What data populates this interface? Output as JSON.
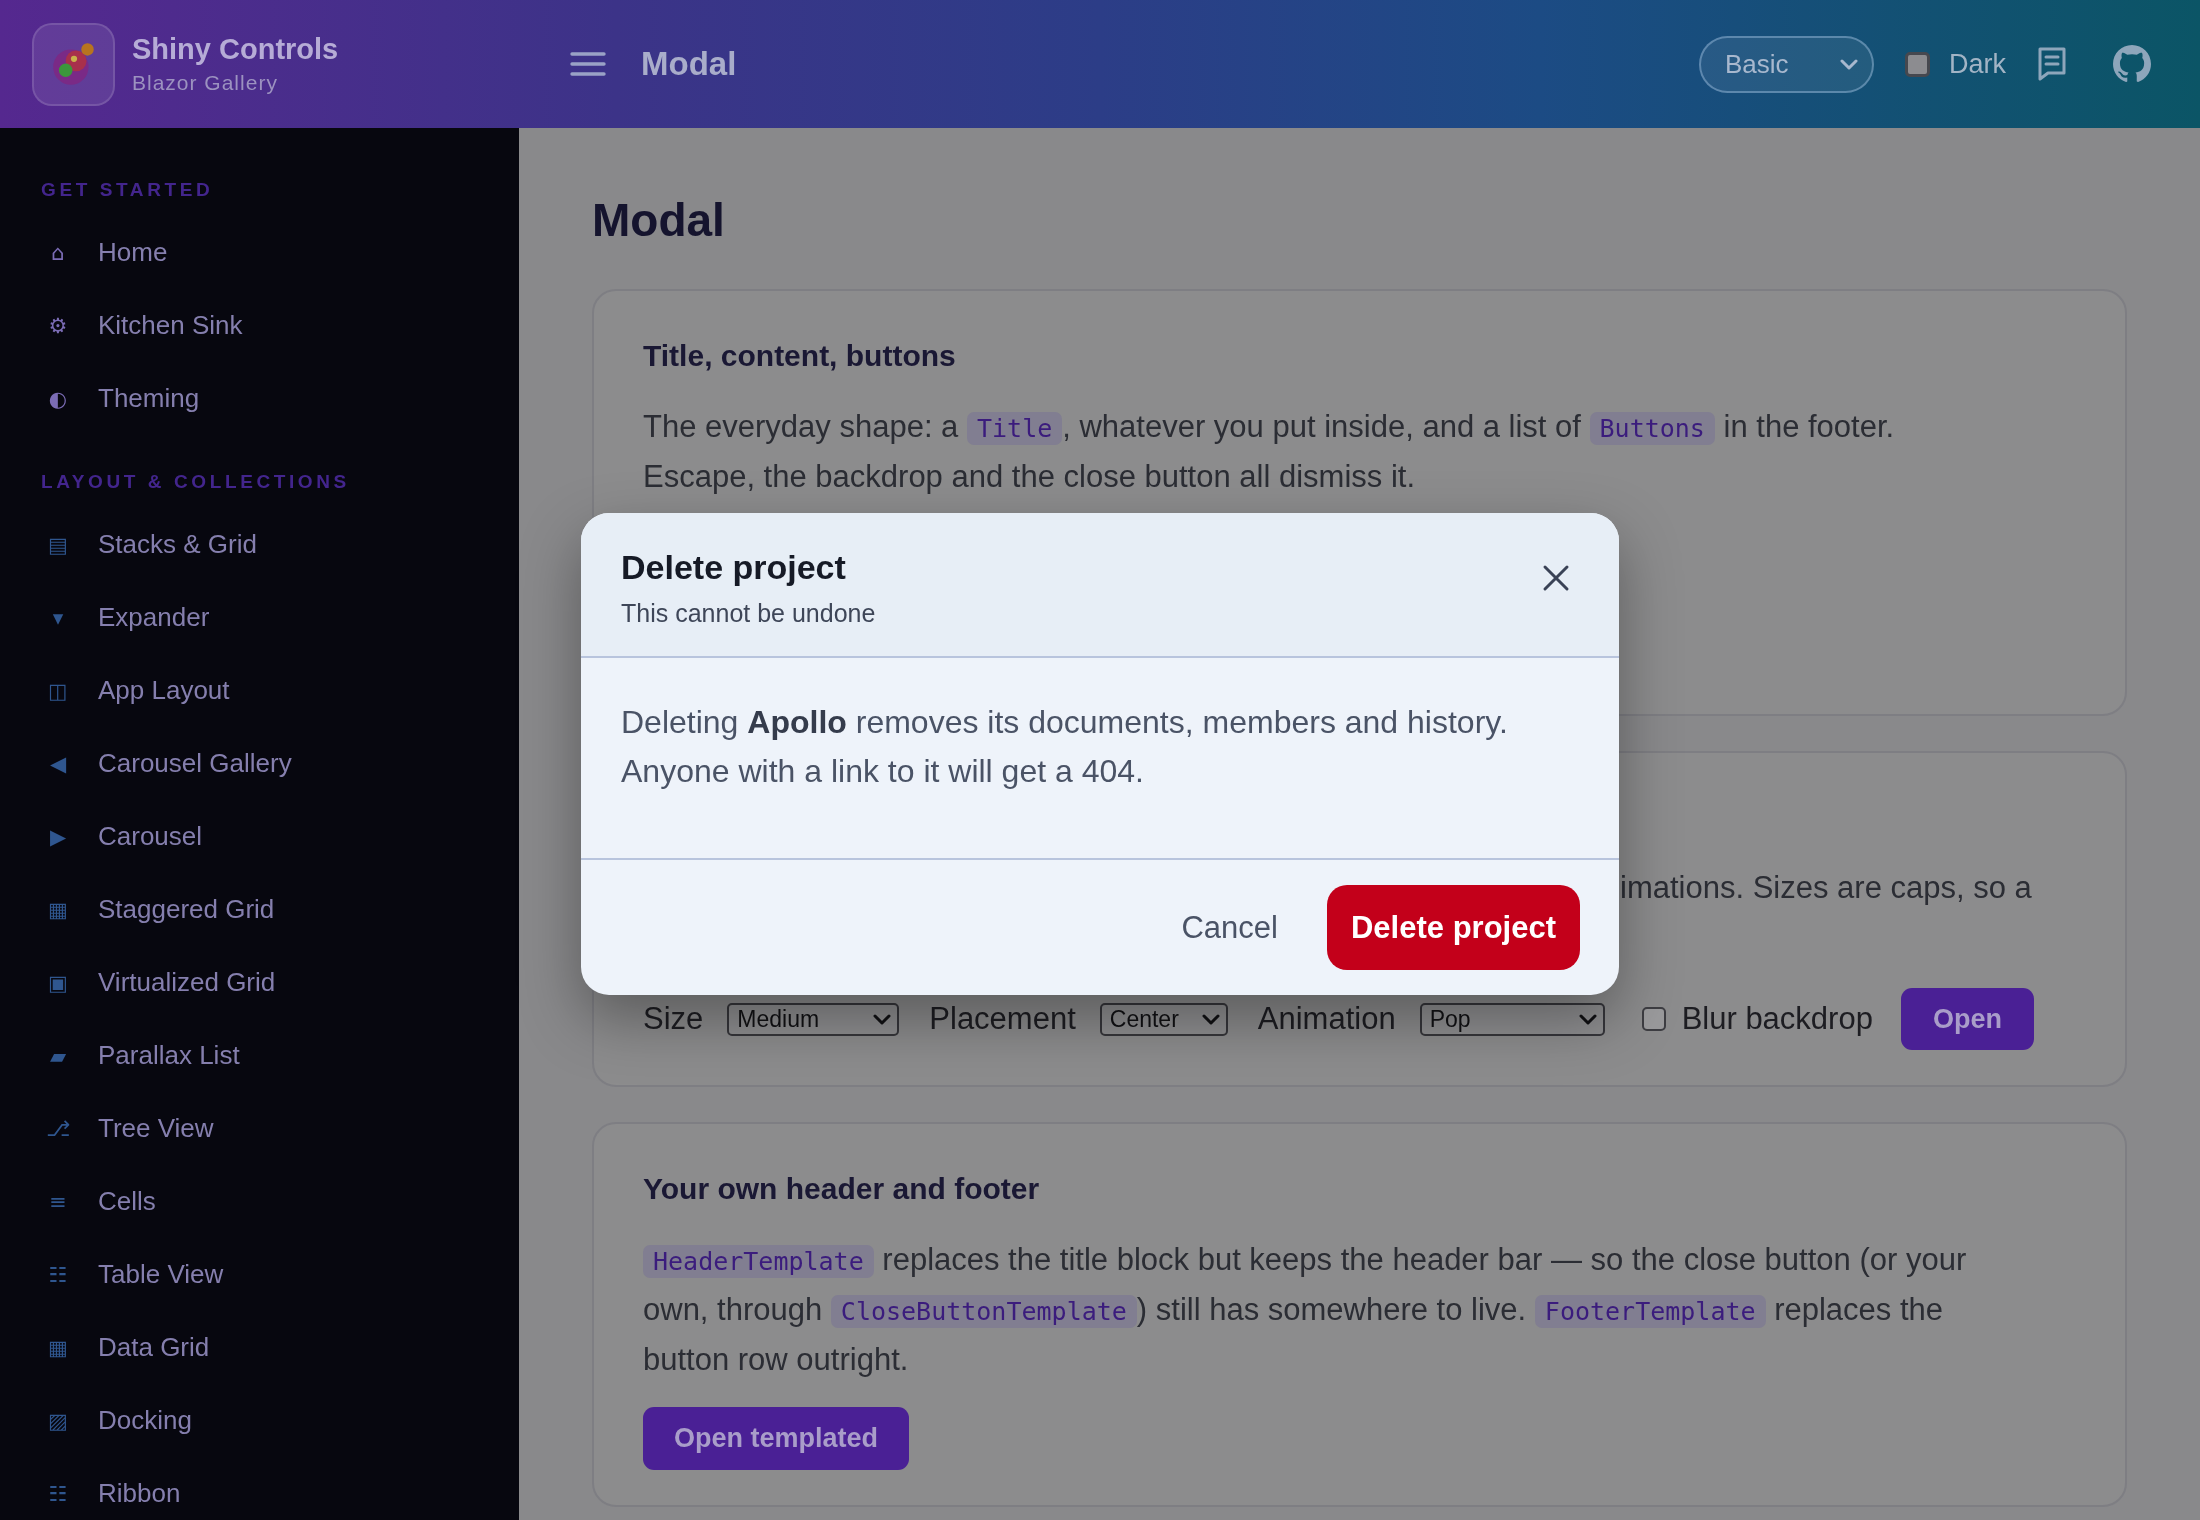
{
  "header": {
    "app_title": "Shiny Controls",
    "app_subtitle": "Blazor Gallery",
    "page_title": "Modal",
    "theme_select": {
      "value": "Basic"
    },
    "dark_mode": {
      "label": "Dark",
      "checked": false
    }
  },
  "sidebar": {
    "sections": [
      {
        "title": "GET STARTED",
        "items": [
          {
            "icon": "⌂",
            "label": "Home",
            "selected": false
          },
          {
            "icon": "⚙",
            "label": "Kitchen Sink",
            "selected": false
          },
          {
            "icon": "◐",
            "label": "Theming",
            "selected": false
          }
        ]
      },
      {
        "title": "LAYOUT & COLLECTIONS",
        "items": [
          {
            "icon": "▤",
            "label": "Stacks & Grid",
            "selected": false
          },
          {
            "icon": "▾",
            "label": "Expander",
            "selected": false
          },
          {
            "icon": "◫",
            "label": "App Layout",
            "selected": false
          },
          {
            "icon": "◀",
            "label": "Carousel Gallery",
            "selected": false
          },
          {
            "icon": "▶",
            "label": "Carousel",
            "selected": false
          },
          {
            "icon": "▦",
            "label": "Staggered Grid",
            "selected": false
          },
          {
            "icon": "▣",
            "label": "Virtualized Grid",
            "selected": false
          },
          {
            "icon": "▰",
            "label": "Parallax List",
            "selected": false
          },
          {
            "icon": "⎇",
            "label": "Tree View",
            "selected": false
          },
          {
            "icon": "≡",
            "label": "Cells",
            "selected": false
          },
          {
            "icon": "☷",
            "label": "Table View",
            "selected": false
          },
          {
            "icon": "▦",
            "label": "Data Grid",
            "selected": false
          },
          {
            "icon": "▨",
            "label": "Docking",
            "selected": false
          },
          {
            "icon": "☷",
            "label": "Ribbon",
            "selected": false
          }
        ]
      }
    ]
  },
  "page": {
    "heading": "Modal",
    "cards": [
      {
        "kind": "text",
        "title": "Title, content, buttons",
        "paragraph": [
          {
            "kind": "text",
            "text": "The everyday shape: a "
          },
          {
            "kind": "code",
            "text": "Title"
          },
          {
            "kind": "text",
            "text": ", whatever you put inside, and a list of "
          },
          {
            "kind": "code",
            "text": "Buttons"
          },
          {
            "kind": "text",
            "text": " in the footer. Escape, the backdrop and the close button all dismiss it."
          }
        ]
      },
      {
        "kind": "controls",
        "text_fragment": "imations. Sizes are caps, so a",
        "controls": [
          {
            "kind": "select",
            "label": "Size",
            "value": "Medium"
          },
          {
            "kind": "select",
            "label": "Placement",
            "value": "Center"
          },
          {
            "kind": "select",
            "label": "Animation",
            "value": "Pop"
          },
          {
            "kind": "checkbox",
            "label": "Blur backdrop",
            "checked": false
          },
          {
            "kind": "button",
            "label": "Open"
          }
        ]
      },
      {
        "kind": "text",
        "title": "Your own header and footer",
        "paragraph": [
          {
            "kind": "code",
            "text": "HeaderTemplate"
          },
          {
            "kind": "text",
            "text": " replaces the title block but keeps the header bar — so the close button (or your own, through "
          },
          {
            "kind": "code",
            "text": "CloseButtonTemplate"
          },
          {
            "kind": "text",
            "text": ") still has somewhere to live. "
          },
          {
            "kind": "code",
            "text": "FooterTemplate"
          },
          {
            "kind": "text",
            "text": " replaces the button row outright."
          }
        ],
        "button": "Open templated"
      }
    ]
  },
  "modal": {
    "title": "Delete project",
    "subtitle": "This cannot be undone",
    "message": "Deleting **Apollo** removes its documents, members and history. Anyone with a link to it will get a 404.",
    "buttons": [
      {
        "kind": "secondary",
        "label": "Cancel"
      },
      {
        "kind": "danger",
        "label": "Delete project"
      }
    ]
  }
}
